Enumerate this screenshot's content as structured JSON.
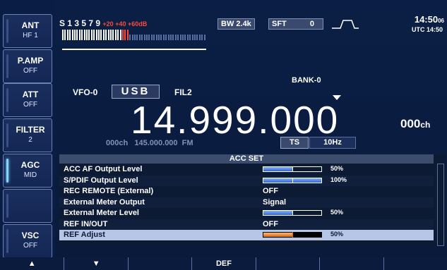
{
  "softkeys": [
    {
      "name": "ANT",
      "value": "HF 1"
    },
    {
      "name": "P.AMP",
      "value": "OFF"
    },
    {
      "name": "ATT",
      "value": "OFF"
    },
    {
      "name": "FILTER",
      "value": "2"
    },
    {
      "name": "AGC",
      "value": "MID"
    },
    {
      "name": "",
      "value": ""
    },
    {
      "name": "VSC",
      "value": "OFF"
    }
  ],
  "meter": {
    "label": "S",
    "ticks_white": "1  3  5  7  9",
    "ticks_red": "+20  +40  +60dB"
  },
  "top": {
    "bw_label": "BW",
    "bw_value": "2.4k",
    "sft_label": "SFT",
    "sft_value": "0"
  },
  "clock": {
    "time": "14:50",
    "seconds": "06",
    "utc": "UTC 14:50"
  },
  "vfo": {
    "bank": "BANK-0",
    "label": "VFO-0",
    "mode": "USB",
    "fil": "FIL2",
    "frequency": "14.999.000",
    "memory": "000",
    "memory_unit": "ch",
    "sub_memory": "000ch",
    "sub_freq": "145.000.000",
    "sub_mode": "FM",
    "ts_label": "TS",
    "ts_value": "10Hz"
  },
  "menu": {
    "title": "ACC SET",
    "rows": [
      {
        "label": "ACC AF Output Level",
        "type": "bar",
        "level": 0.5,
        "value": "50%"
      },
      {
        "label": "S/PDIF Output Level",
        "type": "bar",
        "level": 1.0,
        "value": "100%"
      },
      {
        "label": "REC REMOTE (External)",
        "type": "text",
        "value": "OFF"
      },
      {
        "label": "External Meter Output",
        "type": "text",
        "value": "Signal"
      },
      {
        "label": "External Meter Level",
        "type": "bar",
        "level": 0.5,
        "value": "50%"
      },
      {
        "label": "REF IN/OUT",
        "type": "text",
        "value": "OFF"
      },
      {
        "label": "REF Adjust",
        "type": "bar",
        "level": 0.5,
        "value": "50%",
        "selected": true
      }
    ]
  },
  "fkeys": [
    {
      "label": "▲",
      "icon": "up-arrow-icon"
    },
    {
      "label": "▼",
      "icon": "down-arrow-icon"
    },
    {
      "label": ""
    },
    {
      "label": "DEF"
    },
    {
      "label": ""
    },
    {
      "label": ""
    },
    {
      "label": ""
    }
  ]
}
